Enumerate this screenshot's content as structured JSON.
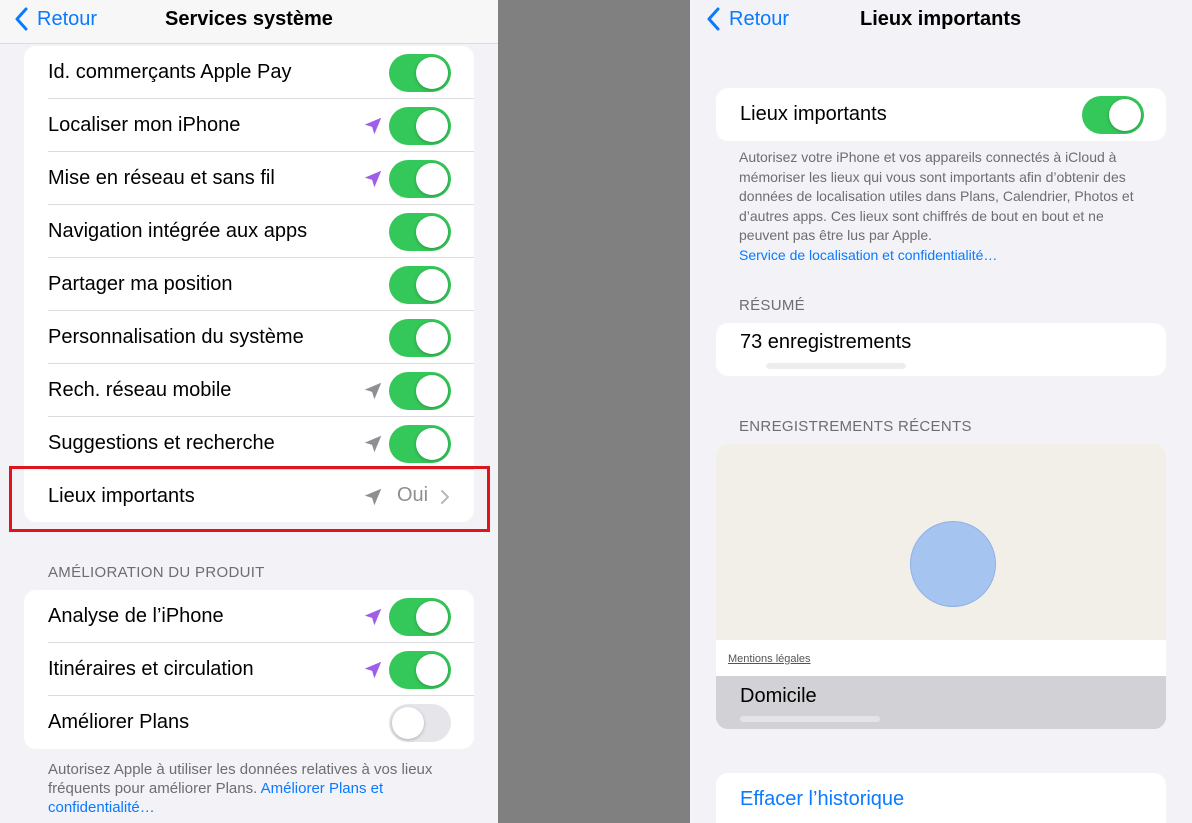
{
  "left": {
    "nav": {
      "back_label": "Retour",
      "title": "Services système"
    },
    "rows": [
      {
        "label": "Id. commerçants Apple Pay",
        "arrow": "none",
        "toggle": "on"
      },
      {
        "label": "Localiser mon iPhone",
        "arrow": "purple",
        "toggle": "on"
      },
      {
        "label": "Mise en réseau et sans fil",
        "arrow": "purple",
        "toggle": "on"
      },
      {
        "label": "Navigation intégrée aux apps",
        "arrow": "none",
        "toggle": "on"
      },
      {
        "label": "Partager ma position",
        "arrow": "none",
        "toggle": "on"
      },
      {
        "label": "Personnalisation du système",
        "arrow": "none",
        "toggle": "on"
      },
      {
        "label": "Rech. réseau mobile",
        "arrow": "gray",
        "toggle": "on"
      },
      {
        "label": "Suggestions et recherche",
        "arrow": "gray",
        "toggle": "on"
      },
      {
        "label": "Lieux importants",
        "arrow": "gray",
        "value": "Oui"
      }
    ],
    "product_section": {
      "header": "AMÉLIORATION DU PRODUIT",
      "rows": [
        {
          "label": "Analyse de l’iPhone",
          "arrow": "purple",
          "toggle": "on"
        },
        {
          "label": "Itinéraires et circulation",
          "arrow": "purple",
          "toggle": "on"
        },
        {
          "label": "Améliorer Plans",
          "arrow": "none",
          "toggle": "off"
        }
      ],
      "footer_text": "Autorisez Apple à utiliser les données relatives à vos lieux fréquents pour améliorer Plans.",
      "footer_link": "Améliorer Plans et confidentialité…"
    }
  },
  "right": {
    "nav": {
      "back_label": "Retour",
      "title": "Lieux importants"
    },
    "main_toggle": {
      "label": "Lieux importants",
      "state": "on"
    },
    "description": "Autorisez votre iPhone et vos appareils connectés à iCloud à mémoriser les lieux qui vous sont importants afin d’obtenir des données de localisation utiles dans Plans, Calendrier, Photos et d’autres apps. Ces lieux sont chiffrés de bout en bout et ne peuvent pas être lus par Apple.",
    "description_link": "Service de localisation et confidentialité…",
    "summary_header": "RÉSUMÉ",
    "summary_value": "73 enregistrements",
    "recent_header": "ENREGISTREMENTS RÉCENTS",
    "map_legal": "Mentions légales",
    "place_label": "Domicile",
    "clear_history": "Effacer l’historique"
  },
  "colors": {
    "accent_blue": "#0a7aff",
    "toggle_green": "#34c759",
    "purple_arrow": "#a05ee8",
    "gray_arrow": "#8e8e93",
    "highlight_red": "#e0141c",
    "map_circle": "#a6c4f0"
  },
  "icons": {
    "back": "chevron-left-icon",
    "location": "location-arrow-icon",
    "disclosure": "chevron-right-icon"
  }
}
